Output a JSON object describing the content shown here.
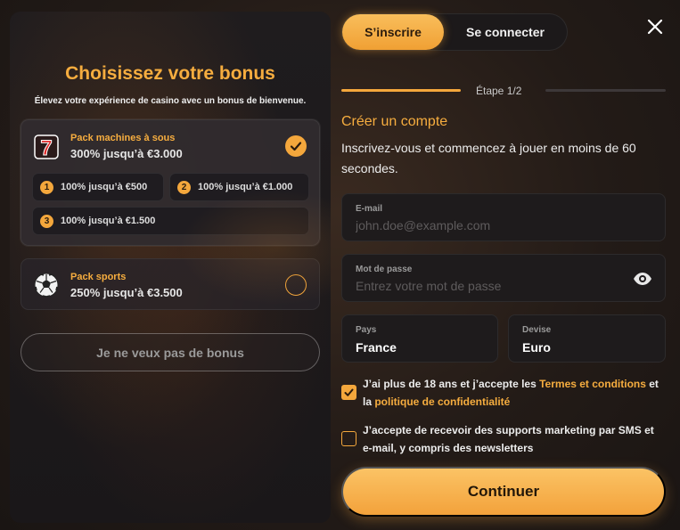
{
  "bonus_panel": {
    "title": "Choisissez votre bonus",
    "subtitle": "Élevez votre expérience de casino avec un bonus de bienvenue.",
    "packs": [
      {
        "name": "Pack machines à sous",
        "value": "300% jusqu’à €3.000",
        "icon": "slot-seven-icon",
        "selected": true,
        "options": [
          {
            "num": "1",
            "label": "100% jusqu’à €500"
          },
          {
            "num": "2",
            "label": "100% jusqu’à €1.000"
          },
          {
            "num": "3",
            "label": "100% jusqu’à €1.500"
          }
        ]
      },
      {
        "name": "Pack sports",
        "value": "250% jusqu’à €3.500",
        "icon": "soccer-ball-icon",
        "selected": false
      }
    ],
    "no_bonus_label": "Je ne veux pas de bonus"
  },
  "tabs": {
    "register": "S’inscrire",
    "login": "Se connecter",
    "active": "register"
  },
  "progress": {
    "label": "Étape 1/2",
    "fraction": 0.5
  },
  "form": {
    "title": "Créer un compte",
    "subtitle": "Inscrivez-vous et commencez à jouer en moins de 60 secondes.",
    "email": {
      "label": "E-mail",
      "placeholder": "john.doe@example.com",
      "value": ""
    },
    "password": {
      "label": "Mot de passe",
      "placeholder": "Entrez votre mot de passe",
      "value": ""
    },
    "country": {
      "label": "Pays",
      "value": "France"
    },
    "currency": {
      "label": "Devise",
      "value": "Euro"
    },
    "terms": {
      "checked": true,
      "text_before": "J’ai plus de 18 ans et j’accepte les ",
      "terms_link": "Termes et conditions",
      "text_middle": " et la ",
      "privacy_link": "politique de confidentialité"
    },
    "marketing": {
      "checked": false,
      "text": "J’accepte de recevoir des supports marketing par SMS et e-mail, y compris des newsletters"
    },
    "continue_label": "Continuer"
  },
  "colors": {
    "accent": "#f4a73c",
    "background": "#231b17"
  }
}
